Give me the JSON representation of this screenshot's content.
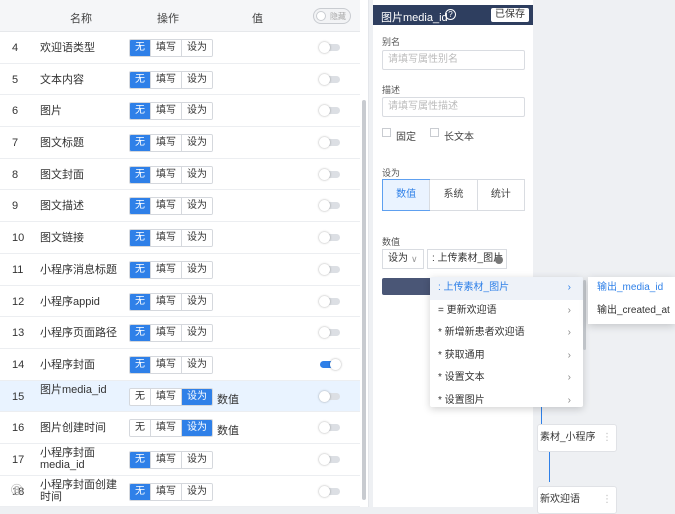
{
  "table": {
    "headers": {
      "name": "名称",
      "op": "操作",
      "value": "值"
    },
    "header_toggle": "隐藏",
    "op_labels": [
      "无",
      "填写",
      "设为"
    ],
    "rows": [
      {
        "num": "4",
        "name": "欢迎语类型",
        "sel": 0,
        "value": "",
        "toggle": false
      },
      {
        "num": "5",
        "name": "文本内容",
        "sel": 0,
        "value": "",
        "toggle": false
      },
      {
        "num": "6",
        "name": "图片",
        "sel": 0,
        "value": "",
        "toggle": false
      },
      {
        "num": "7",
        "name": "图文标题",
        "sel": 0,
        "value": "",
        "toggle": false
      },
      {
        "num": "8",
        "name": "图文封面",
        "sel": 0,
        "value": "",
        "toggle": false
      },
      {
        "num": "9",
        "name": "图文描述",
        "sel": 0,
        "value": "",
        "toggle": false
      },
      {
        "num": "10",
        "name": "图文链接",
        "sel": 0,
        "value": "",
        "toggle": false
      },
      {
        "num": "11",
        "name": "小程序消息标题",
        "sel": 0,
        "value": "",
        "toggle": false
      },
      {
        "num": "12",
        "name": "小程序appid",
        "sel": 0,
        "value": "",
        "toggle": false
      },
      {
        "num": "13",
        "name": "小程序页面路径",
        "sel": 0,
        "value": "",
        "toggle": false
      },
      {
        "num": "14",
        "name": "小程序封面",
        "sel": 0,
        "value": "",
        "toggle": true
      },
      {
        "num": "15",
        "name": "图片media_id",
        "sel": 2,
        "value": "数值",
        "toggle": false,
        "selected": true
      },
      {
        "num": "16",
        "name": "图片创建时间",
        "sel": 2,
        "value": "数值",
        "toggle": false
      },
      {
        "num": "17",
        "name": "小程序封面media_id",
        "sel": 0,
        "value": "",
        "toggle": false
      },
      {
        "num": "18",
        "name": "小程序封面创建时间",
        "sel": 0,
        "value": "",
        "toggle": false
      }
    ]
  },
  "footer_glyph": "⑧",
  "panel": {
    "title": "图片media_id",
    "help_icon": "?",
    "saved": "已保存",
    "alias_label": "别名",
    "alias_placeholder": "请填写属性别名",
    "desc_label": "描述",
    "desc_placeholder": "请填写属性描述",
    "fixed_label": "固定",
    "longtext_label": "长文本",
    "role_label": "设为",
    "roles": [
      "数值",
      "系统",
      "统计"
    ],
    "value_label": "数值",
    "select_value": "设为",
    "select_caret": "∨",
    "value_text": ": 上传素材_图片"
  },
  "dropdown": {
    "items": [
      ": 上传素材_图片",
      "= 更新欢迎语",
      "* 新增新患者欢迎语",
      "* 获取通用",
      "* 设置文本",
      "* 设置图片"
    ],
    "arrow": "›",
    "sub_items": [
      "输出_media_id",
      "输出_created_at"
    ]
  },
  "canvas": {
    "nodes": [
      "素材_小程序",
      "新欢迎语"
    ],
    "dots": "⋮"
  },
  "colors": {
    "accent": "#2f80e8",
    "header": "#2e3e5f"
  }
}
